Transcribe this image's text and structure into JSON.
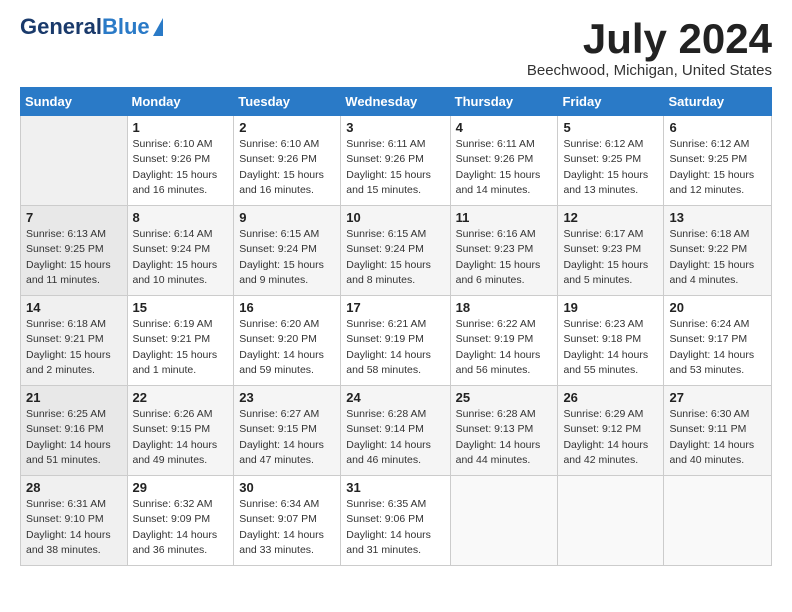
{
  "logo": {
    "general": "General",
    "blue": "Blue"
  },
  "title": "July 2024",
  "location": "Beechwood, Michigan, United States",
  "days_of_week": [
    "Sunday",
    "Monday",
    "Tuesday",
    "Wednesday",
    "Thursday",
    "Friday",
    "Saturday"
  ],
  "weeks": [
    [
      {
        "day": "",
        "info": ""
      },
      {
        "day": "1",
        "info": "Sunrise: 6:10 AM\nSunset: 9:26 PM\nDaylight: 15 hours\nand 16 minutes."
      },
      {
        "day": "2",
        "info": "Sunrise: 6:10 AM\nSunset: 9:26 PM\nDaylight: 15 hours\nand 16 minutes."
      },
      {
        "day": "3",
        "info": "Sunrise: 6:11 AM\nSunset: 9:26 PM\nDaylight: 15 hours\nand 15 minutes."
      },
      {
        "day": "4",
        "info": "Sunrise: 6:11 AM\nSunset: 9:26 PM\nDaylight: 15 hours\nand 14 minutes."
      },
      {
        "day": "5",
        "info": "Sunrise: 6:12 AM\nSunset: 9:25 PM\nDaylight: 15 hours\nand 13 minutes."
      },
      {
        "day": "6",
        "info": "Sunrise: 6:12 AM\nSunset: 9:25 PM\nDaylight: 15 hours\nand 12 minutes."
      }
    ],
    [
      {
        "day": "7",
        "info": "Sunrise: 6:13 AM\nSunset: 9:25 PM\nDaylight: 15 hours\nand 11 minutes."
      },
      {
        "day": "8",
        "info": "Sunrise: 6:14 AM\nSunset: 9:24 PM\nDaylight: 15 hours\nand 10 minutes."
      },
      {
        "day": "9",
        "info": "Sunrise: 6:15 AM\nSunset: 9:24 PM\nDaylight: 15 hours\nand 9 minutes."
      },
      {
        "day": "10",
        "info": "Sunrise: 6:15 AM\nSunset: 9:24 PM\nDaylight: 15 hours\nand 8 minutes."
      },
      {
        "day": "11",
        "info": "Sunrise: 6:16 AM\nSunset: 9:23 PM\nDaylight: 15 hours\nand 6 minutes."
      },
      {
        "day": "12",
        "info": "Sunrise: 6:17 AM\nSunset: 9:23 PM\nDaylight: 15 hours\nand 5 minutes."
      },
      {
        "day": "13",
        "info": "Sunrise: 6:18 AM\nSunset: 9:22 PM\nDaylight: 15 hours\nand 4 minutes."
      }
    ],
    [
      {
        "day": "14",
        "info": "Sunrise: 6:18 AM\nSunset: 9:21 PM\nDaylight: 15 hours\nand 2 minutes."
      },
      {
        "day": "15",
        "info": "Sunrise: 6:19 AM\nSunset: 9:21 PM\nDaylight: 15 hours\nand 1 minute."
      },
      {
        "day": "16",
        "info": "Sunrise: 6:20 AM\nSunset: 9:20 PM\nDaylight: 14 hours\nand 59 minutes."
      },
      {
        "day": "17",
        "info": "Sunrise: 6:21 AM\nSunset: 9:19 PM\nDaylight: 14 hours\nand 58 minutes."
      },
      {
        "day": "18",
        "info": "Sunrise: 6:22 AM\nSunset: 9:19 PM\nDaylight: 14 hours\nand 56 minutes."
      },
      {
        "day": "19",
        "info": "Sunrise: 6:23 AM\nSunset: 9:18 PM\nDaylight: 14 hours\nand 55 minutes."
      },
      {
        "day": "20",
        "info": "Sunrise: 6:24 AM\nSunset: 9:17 PM\nDaylight: 14 hours\nand 53 minutes."
      }
    ],
    [
      {
        "day": "21",
        "info": "Sunrise: 6:25 AM\nSunset: 9:16 PM\nDaylight: 14 hours\nand 51 minutes."
      },
      {
        "day": "22",
        "info": "Sunrise: 6:26 AM\nSunset: 9:15 PM\nDaylight: 14 hours\nand 49 minutes."
      },
      {
        "day": "23",
        "info": "Sunrise: 6:27 AM\nSunset: 9:15 PM\nDaylight: 14 hours\nand 47 minutes."
      },
      {
        "day": "24",
        "info": "Sunrise: 6:28 AM\nSunset: 9:14 PM\nDaylight: 14 hours\nand 46 minutes."
      },
      {
        "day": "25",
        "info": "Sunrise: 6:28 AM\nSunset: 9:13 PM\nDaylight: 14 hours\nand 44 minutes."
      },
      {
        "day": "26",
        "info": "Sunrise: 6:29 AM\nSunset: 9:12 PM\nDaylight: 14 hours\nand 42 minutes."
      },
      {
        "day": "27",
        "info": "Sunrise: 6:30 AM\nSunset: 9:11 PM\nDaylight: 14 hours\nand 40 minutes."
      }
    ],
    [
      {
        "day": "28",
        "info": "Sunrise: 6:31 AM\nSunset: 9:10 PM\nDaylight: 14 hours\nand 38 minutes."
      },
      {
        "day": "29",
        "info": "Sunrise: 6:32 AM\nSunset: 9:09 PM\nDaylight: 14 hours\nand 36 minutes."
      },
      {
        "day": "30",
        "info": "Sunrise: 6:34 AM\nSunset: 9:07 PM\nDaylight: 14 hours\nand 33 minutes."
      },
      {
        "day": "31",
        "info": "Sunrise: 6:35 AM\nSunset: 9:06 PM\nDaylight: 14 hours\nand 31 minutes."
      },
      {
        "day": "",
        "info": ""
      },
      {
        "day": "",
        "info": ""
      },
      {
        "day": "",
        "info": ""
      }
    ]
  ]
}
